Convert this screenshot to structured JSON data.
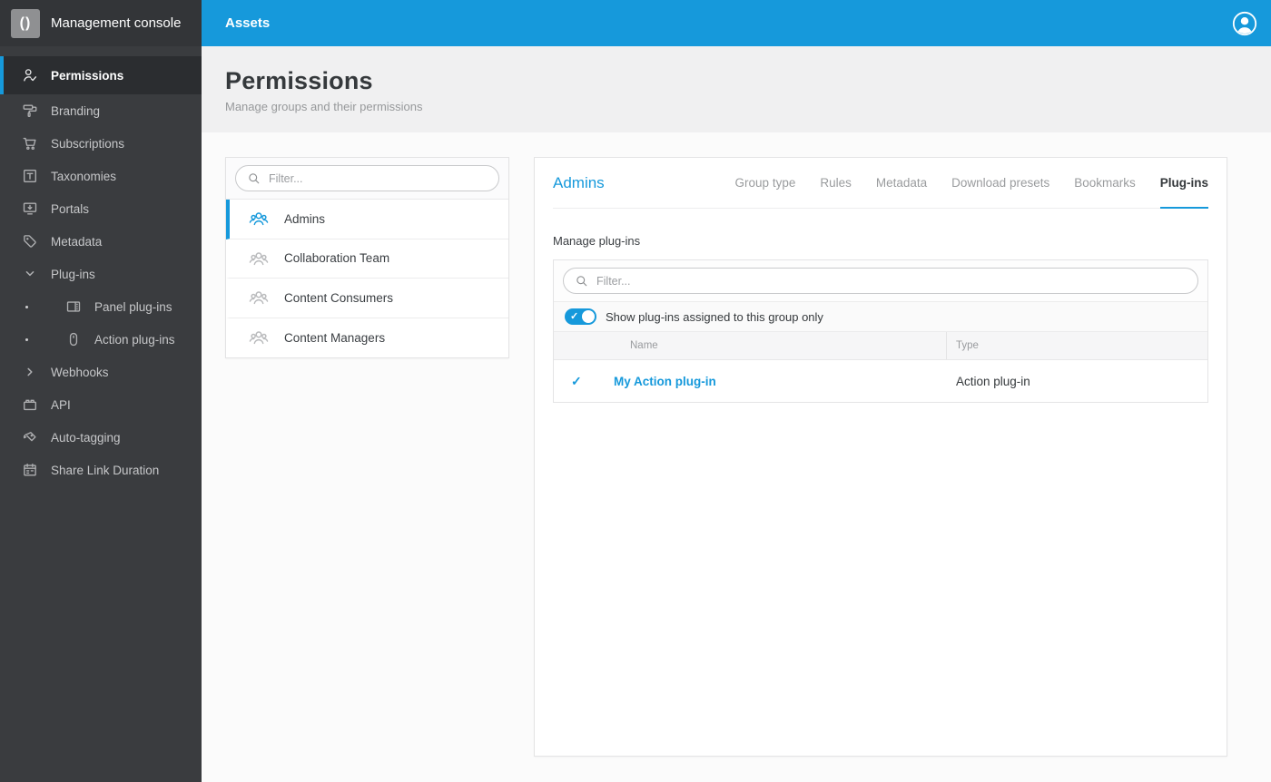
{
  "app": {
    "sidebar_title": "Management console",
    "topbar_title": "Assets",
    "accent_color": "#1699db",
    "sidebar_color": "#3a3c3f"
  },
  "sidebar": {
    "items": [
      {
        "label": "Permissions",
        "icon": "person-check-icon",
        "active": true
      },
      {
        "label": "Branding",
        "icon": "paint-roller-icon"
      },
      {
        "label": "Subscriptions",
        "icon": "cart-icon"
      },
      {
        "label": "Taxonomies",
        "icon": "taxonomy-icon"
      },
      {
        "label": "Portals",
        "icon": "portal-icon"
      },
      {
        "label": "Metadata",
        "icon": "tag-icon"
      },
      {
        "label": "Plug-ins",
        "icon": "chevron-down-icon",
        "expanded": true
      },
      {
        "label": "Panel plug-ins",
        "icon": "panel-plugin-icon",
        "child": true
      },
      {
        "label": "Action plug-ins",
        "icon": "action-plugin-icon",
        "child": true
      },
      {
        "label": "Webhooks",
        "icon": "chevron-right-icon",
        "expanded": false
      },
      {
        "label": "API",
        "icon": "api-icon"
      },
      {
        "label": "Auto-tagging",
        "icon": "auto-tagging-icon"
      },
      {
        "label": "Share Link Duration",
        "icon": "calendar-icon"
      }
    ]
  },
  "page": {
    "title": "Permissions",
    "subtitle": "Manage groups and their permissions"
  },
  "groups": {
    "filter_placeholder": "Filter...",
    "items": [
      {
        "name": "Admins",
        "selected": true
      },
      {
        "name": "Collaboration Team",
        "selected": false
      },
      {
        "name": "Content Consumers",
        "selected": false
      },
      {
        "name": "Content Managers",
        "selected": false
      }
    ]
  },
  "detail": {
    "title": "Admins",
    "tabs": [
      {
        "label": "Group type",
        "active": false
      },
      {
        "label": "Rules",
        "active": false
      },
      {
        "label": "Metadata",
        "active": false
      },
      {
        "label": "Download presets",
        "active": false
      },
      {
        "label": "Bookmarks",
        "active": false
      },
      {
        "label": "Plug-ins",
        "active": true
      }
    ],
    "section_title": "Manage plug-ins",
    "filter_placeholder": "Filter...",
    "toggle": {
      "label": "Show plug-ins assigned to this group only",
      "on": true,
      "check_glyph": "✓"
    },
    "table": {
      "columns": {
        "name": "Name",
        "type": "Type"
      },
      "rows": [
        {
          "assigned": true,
          "assigned_glyph": "✓",
          "name": "My Action plug-in",
          "type": "Action plug-in"
        }
      ]
    }
  }
}
